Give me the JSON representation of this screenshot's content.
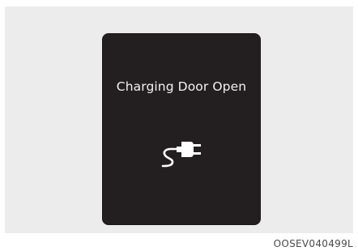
{
  "display": {
    "message": "Charging Door Open",
    "icon": "charging-plug-icon",
    "background_color": "#231f20",
    "text_color": "#f2f2f2"
  },
  "figure": {
    "code": "OOSEV040499L"
  }
}
